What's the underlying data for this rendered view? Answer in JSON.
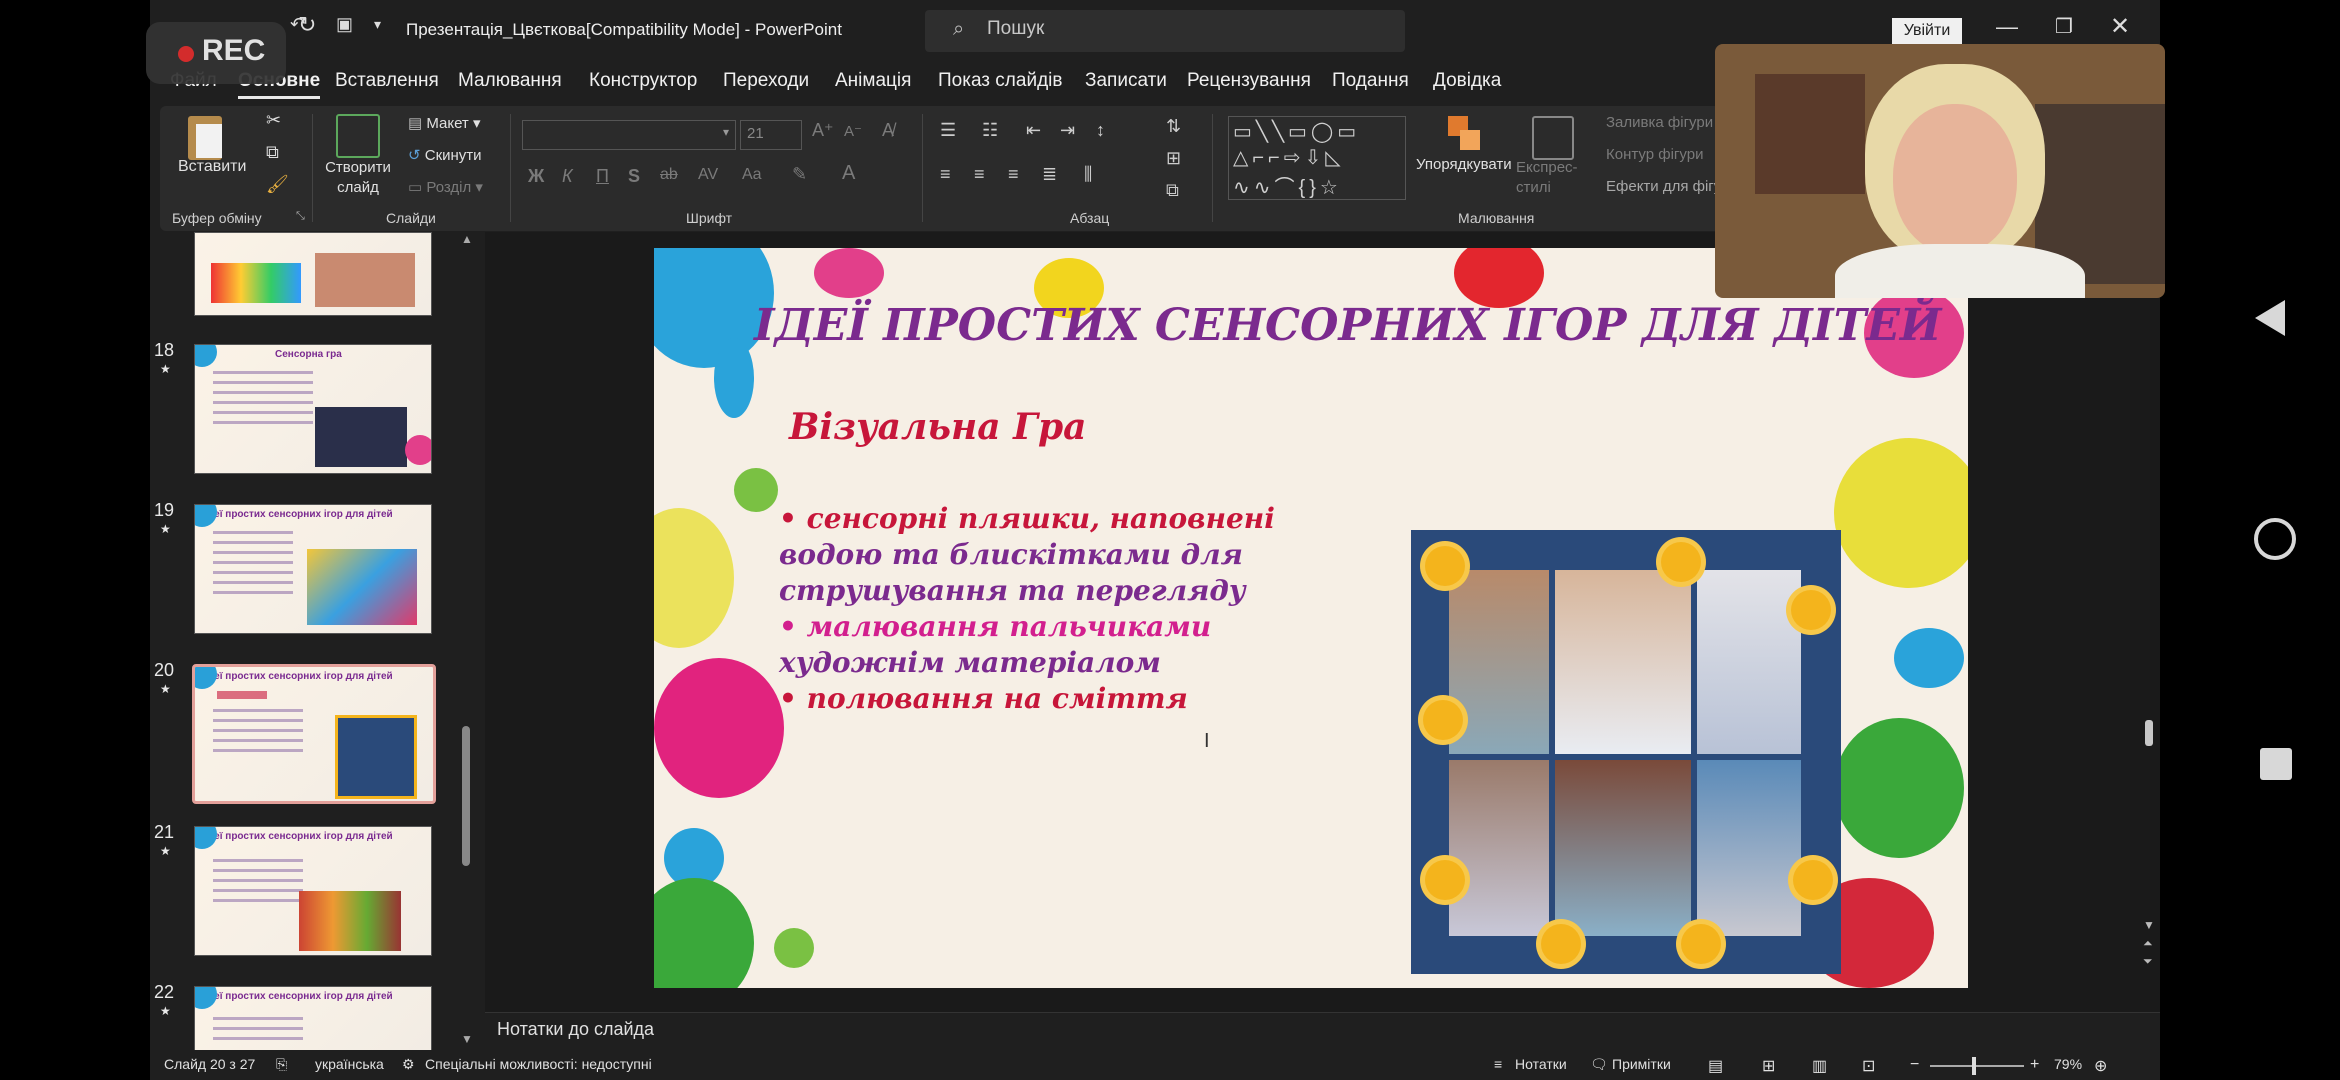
{
  "recording": {
    "label": "REC"
  },
  "titlebar": {
    "doc_title": "Презентація_Цвєткова[Compatibility Mode]  -  PowerPoint",
    "search_placeholder": "Пошук",
    "login_label": "Увійти"
  },
  "tabs": [
    "Файл",
    "Основне",
    "Вставлення",
    "Малювання",
    "Конструктор",
    "Переходи",
    "Анімація",
    "Показ слайдів",
    "Записати",
    "Рецензування",
    "Подання",
    "Довідка"
  ],
  "ribbon": {
    "paste": "Вставити",
    "clipboard_group": "Буфер обміну",
    "new_slide": "Створити слайд",
    "layout": "Макет",
    "reset": "Скинути",
    "section": "Розділ",
    "slides_group": "Слайди",
    "font_name": "",
    "font_size": "21",
    "font_group": "Шрифт",
    "paragraph_group": "Абзац",
    "arrange": "Упорядкувати",
    "quick_styles": "Експрес-стилі",
    "shape_fill": "Заливка фігури",
    "shape_outline": "Контур фігури",
    "shape_effects": "Ефекти для фігури",
    "drawing_group": "Малювання",
    "bold": "Ж",
    "italic": "К",
    "underline": "П",
    "shadow": "S",
    "strike": "ab",
    "aa": "Aa"
  },
  "thumbnails": [
    {
      "num": "18",
      "title": "Сенсорна гра"
    },
    {
      "num": "19",
      "title": "Ідеї простих сенсорних ігор для дітей"
    },
    {
      "num": "20",
      "title": "Ідеї простих сенсорних ігор для дітей"
    },
    {
      "num": "21",
      "title": "Ідеї простих сенсорних ігор для дітей"
    },
    {
      "num": "22",
      "title": "Ідеї простих сенсорних ігор для дітей"
    }
  ],
  "slide": {
    "title": "ІДЕЇ ПРОСТИХ СЕНСОРНИХ ІГОР ДЛЯ ДІТЕЙ",
    "subtitle": "Візуальна Гра",
    "b1_l1": "•   сенсорні   пляшки,   наповнені",
    "b1_l2": "водою    та    блискітками    для",
    "b1_l3": "струшування та перегляду",
    "b2_l1": "•   малювання          пальчиками",
    "b2_l2": "художнім матеріалом",
    "b3_l1": "•   полювання на сміття"
  },
  "notes": {
    "label": "Нотатки до слайда"
  },
  "status": {
    "slide_info": "Слайд 20 з 27",
    "language": "українська",
    "accessibility": "Спеціальні можливості: недоступні",
    "notes_btn": "Нотатки",
    "comments_btn": "Примітки",
    "zoom": "79%"
  },
  "colors": {
    "accent_title": "#7b2a8e",
    "accent_red": "#c7163a",
    "accent_pink": "#d21f8e"
  }
}
